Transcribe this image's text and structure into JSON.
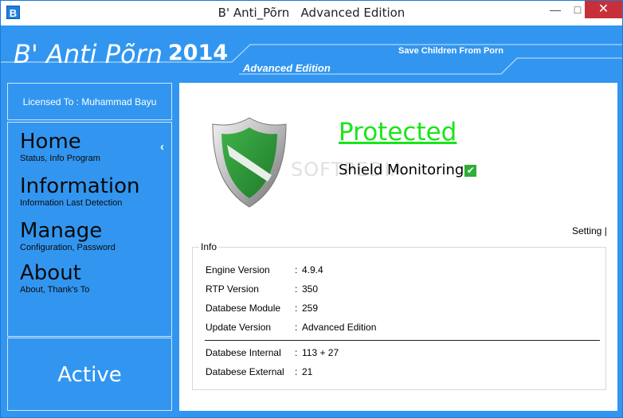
{
  "window": {
    "title": "B' Anti_Põrn   Advanced Edition",
    "app_icon": "B",
    "minimize": "—",
    "maximize": "□",
    "close": "✕"
  },
  "header": {
    "brand": "B' Anti Põrn",
    "year": "2014",
    "slogan": "Save Children From Porn",
    "edition": "Advanced Edition"
  },
  "sidebar": {
    "license": "Licensed To : Muhammad Bayu",
    "collapse_icon": "chevron-left-icon",
    "items": [
      {
        "title": "Home",
        "subtitle": "Status, Info Program"
      },
      {
        "title": "Information",
        "subtitle": "Information Last Detection"
      },
      {
        "title": "Manage",
        "subtitle": "Configuration, Password"
      },
      {
        "title": "About",
        "subtitle": "About, Thank's To"
      }
    ],
    "status": "Active"
  },
  "main": {
    "shield_icon": "shield-icon",
    "status": "Protected",
    "monitoring": "Shield Monitoring",
    "watermark": "SOFTPEDIA",
    "setting_link": "Setting |",
    "info": {
      "legend": "Info",
      "rows": [
        {
          "label": "Engine Version",
          "value": "4.9.4"
        },
        {
          "label": "RTP Version",
          "value": "350"
        },
        {
          "label": "Databese Module",
          "value": "259"
        },
        {
          "label": "Update Version",
          "value": "Advanced Edition"
        },
        {
          "label": "Databese Internal",
          "value": "113 + 27"
        },
        {
          "label": "Databese External",
          "value": "21"
        }
      ],
      "separator": ":"
    }
  },
  "colors": {
    "background": "#3296f0",
    "protected_green": "#19e519",
    "close_red": "#c7303a"
  }
}
